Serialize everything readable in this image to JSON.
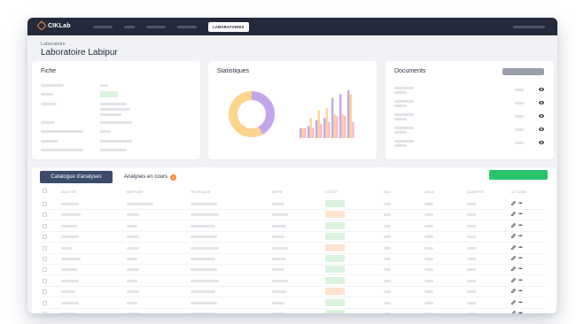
{
  "app": {
    "logo_text": "CIKLab",
    "nav_active_label": "LABORATOIRES"
  },
  "header": {
    "breadcrumb": "Laboratoire",
    "title": "Laboratoire Labipur"
  },
  "cards": {
    "fiche_title": "Fiche",
    "stats_title": "Statistiques",
    "documents_title": "Documents"
  },
  "donut": {
    "segments": [
      {
        "color": "#c1a7ea",
        "fraction": 0.42
      },
      {
        "color": "#fdd48b",
        "fraction": 0.58
      }
    ]
  },
  "bar_chart": {
    "series": [
      {
        "color": "#c1a7ea",
        "values": [
          5,
          6,
          9,
          10,
          20,
          22,
          24
        ]
      },
      {
        "color": "#fdd48b",
        "values": [
          5,
          10,
          14,
          15,
          12,
          12,
          22
        ]
      },
      {
        "color": "#f4b9c4",
        "values": [
          5,
          5,
          7,
          8,
          11,
          11,
          8
        ]
      }
    ]
  },
  "tabs": {
    "catalogue": "Catalogue d'analyses",
    "en_cours": "Analyses en cours",
    "en_cours_count": "2"
  },
  "table": {
    "headers": [
      "ANALYSE",
      "METHODE",
      "TECHNIQUE",
      "UNITE",
      "STATUT",
      "VALI",
      "DELAI",
      "QUANTITE",
      "ACTIONS"
    ],
    "status_colors": [
      "#d9f3df",
      "#ffe3cf",
      "#d9f3df",
      "#d9f3df",
      "#ffe3cf",
      "#d9f3df",
      "#d9f3df",
      "#d9f3df",
      "#ffe3cf",
      "#d9f3df",
      "#d9f3df"
    ],
    "row_count": 11
  },
  "icons": {
    "edit": "pencil-icon",
    "more": "more-dots-icon",
    "eye": "eye-icon"
  }
}
